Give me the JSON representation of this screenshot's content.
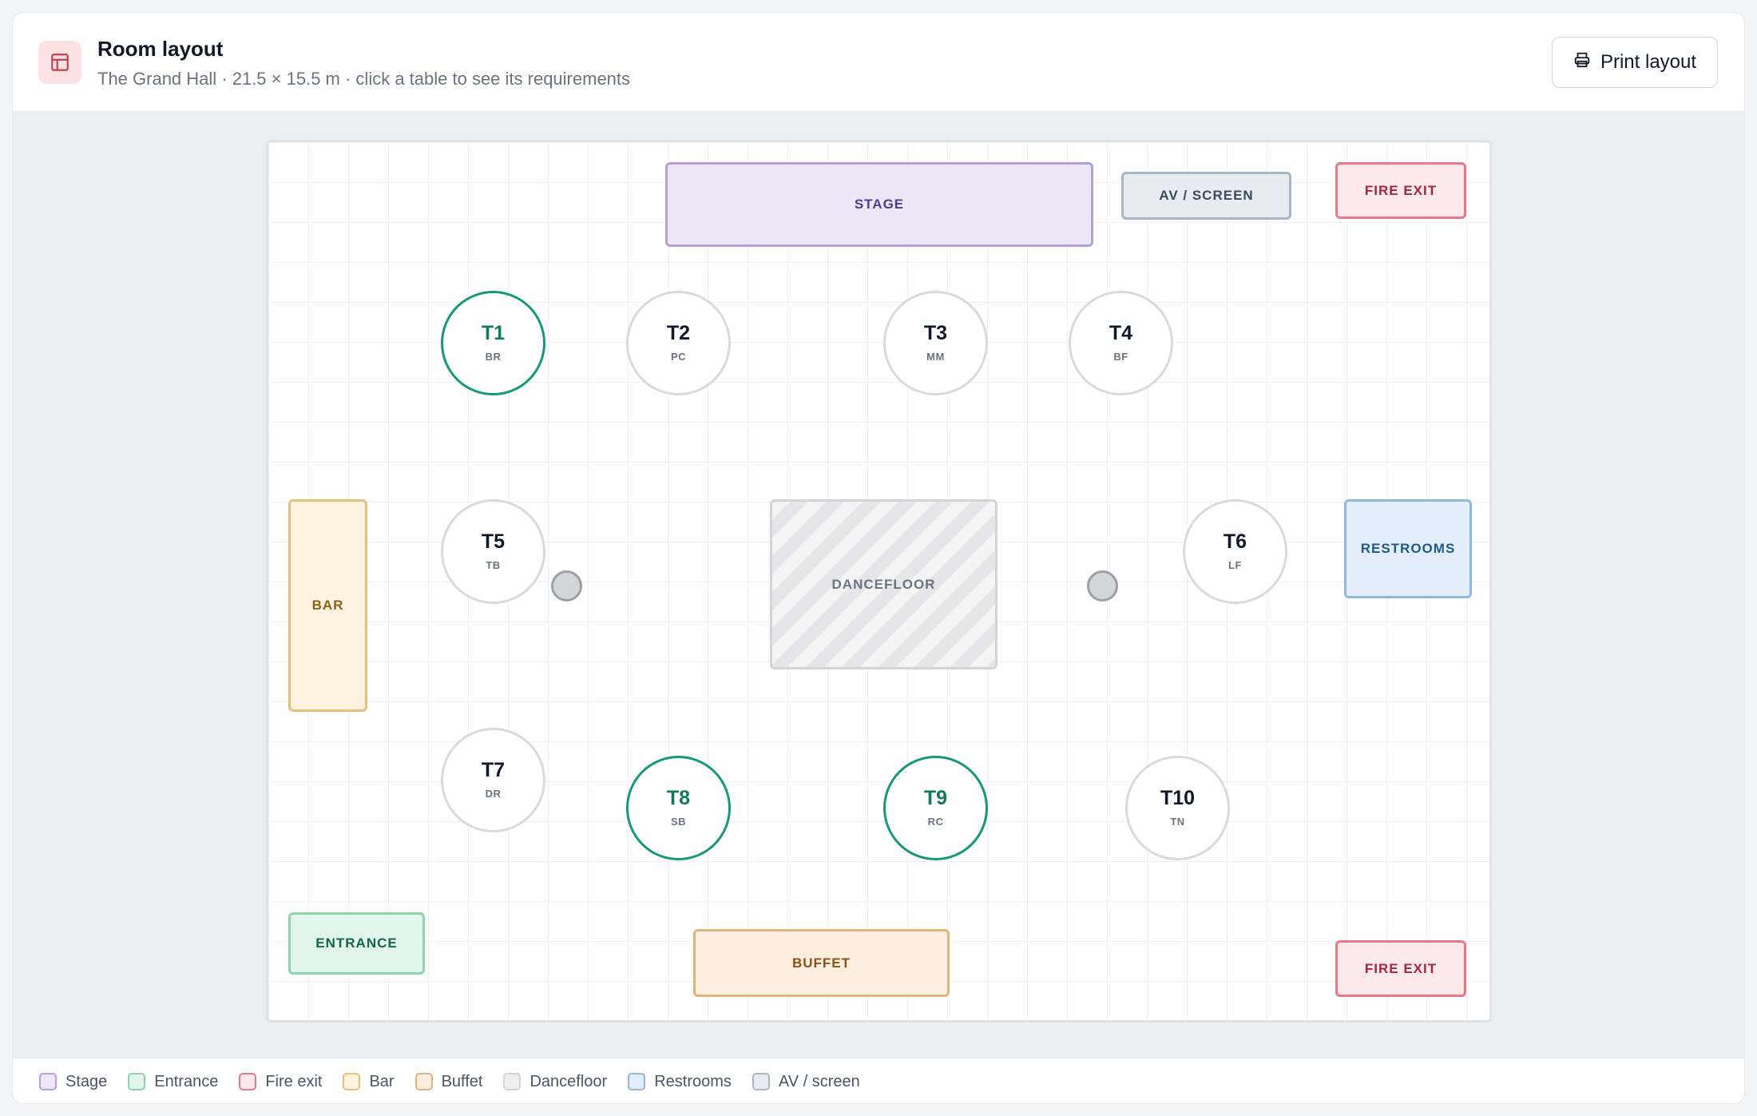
{
  "header": {
    "title": "Room layout",
    "subtitle": "The Grand Hall · 21.5 × 15.5 m · click a table to see its requirements",
    "print_label": "Print layout",
    "icon": "layout-icon",
    "print_icon": "printer-icon"
  },
  "zones": {
    "stage": "STAGE",
    "av": "AV / SCREEN",
    "fire_exit_top": "FIRE EXIT",
    "bar": "BAR",
    "dancefloor": "DANCEFLOOR",
    "restrooms": "RESTROOMS",
    "entrance": "ENTRANCE",
    "buffet": "BUFFET",
    "fire_exit_bottom": "FIRE EXIT"
  },
  "tables": [
    {
      "name": "T1",
      "code": "BR",
      "highlighted": true
    },
    {
      "name": "T2",
      "code": "PC",
      "highlighted": false
    },
    {
      "name": "T3",
      "code": "MM",
      "highlighted": false
    },
    {
      "name": "T4",
      "code": "BF",
      "highlighted": false
    },
    {
      "name": "T5",
      "code": "TB",
      "highlighted": false
    },
    {
      "name": "T6",
      "code": "LF",
      "highlighted": false
    },
    {
      "name": "T7",
      "code": "DR",
      "highlighted": false
    },
    {
      "name": "T8",
      "code": "SB",
      "highlighted": true
    },
    {
      "name": "T9",
      "code": "RC",
      "highlighted": true
    },
    {
      "name": "T10",
      "code": "TN",
      "highlighted": false
    }
  ],
  "legend": [
    {
      "label": "Stage",
      "color": "#b3a0dd"
    },
    {
      "label": "Entrance",
      "color": "#8dd4b3"
    },
    {
      "label": "Fire exit",
      "color": "#e7798a"
    },
    {
      "label": "Bar",
      "color": "#e3c27c"
    },
    {
      "label": "Buffet",
      "color": "#e3b27c"
    },
    {
      "label": "Dancefloor",
      "color": "#d4d4d8"
    },
    {
      "label": "Restrooms",
      "color": "#8eb8dc"
    },
    {
      "label": "AV / screen",
      "color": "#a7b7c8"
    }
  ],
  "colors": {
    "accent_selected": "#16997a",
    "header_icon_bg": "#fde2e4"
  }
}
